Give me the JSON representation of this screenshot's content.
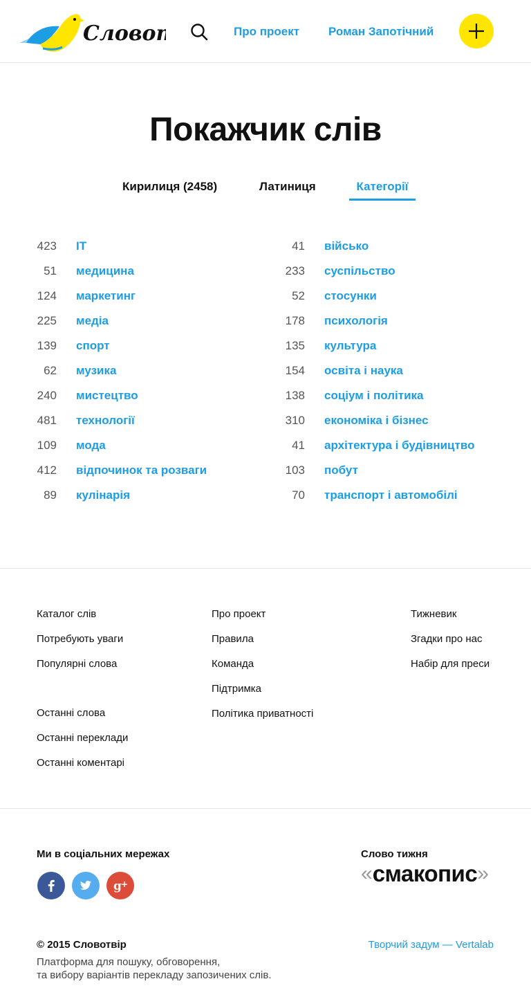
{
  "header": {
    "logo_text": "Словотвір",
    "nav": {
      "about": "Про проект",
      "user": "Роман Запотічний"
    }
  },
  "page": {
    "title": "Покажчик слів",
    "tabs": {
      "cyrillic": "Кирилиця (2458)",
      "latin": "Латиниця",
      "categories": "Категорії"
    }
  },
  "categories": {
    "left": [
      {
        "count": "423",
        "name": "IT"
      },
      {
        "count": "51",
        "name": "медицина"
      },
      {
        "count": "124",
        "name": "маркетинг"
      },
      {
        "count": "225",
        "name": "медіа"
      },
      {
        "count": "139",
        "name": "спорт"
      },
      {
        "count": "62",
        "name": "музика"
      },
      {
        "count": "240",
        "name": "мистецтво"
      },
      {
        "count": "481",
        "name": "технології"
      },
      {
        "count": "109",
        "name": "мода"
      },
      {
        "count": "412",
        "name": "відпочинок та розваги"
      },
      {
        "count": "89",
        "name": "кулінарія"
      }
    ],
    "right": [
      {
        "count": "41",
        "name": "військо"
      },
      {
        "count": "233",
        "name": "суспільство"
      },
      {
        "count": "52",
        "name": "стосунки"
      },
      {
        "count": "178",
        "name": "психологія"
      },
      {
        "count": "135",
        "name": "культура"
      },
      {
        "count": "154",
        "name": "освіта і наука"
      },
      {
        "count": "138",
        "name": "соціум і політика"
      },
      {
        "count": "310",
        "name": "економіка і бізнес"
      },
      {
        "count": "41",
        "name": "архітектура і будівництво"
      },
      {
        "count": "103",
        "name": "побут"
      },
      {
        "count": "70",
        "name": "транспорт і автомобілі"
      }
    ]
  },
  "footer": {
    "col1a": [
      "Каталог слів",
      "Потребують уваги",
      "Популярні слова"
    ],
    "col1b": [
      "Останні слова",
      "Останні переклади",
      "Останні коментарі"
    ],
    "col2": [
      "Про проект",
      "Правила",
      "Команда",
      "Підтримка",
      "Політика приватності"
    ],
    "col3": [
      "Тижневик",
      "Згадки про нас",
      "Набір для преси"
    ],
    "social_title": "Ми в соціальних мережах",
    "word_of_week_title": "Слово тижня",
    "word_of_week": "смакопис",
    "quote_open": "«",
    "quote_close": "»",
    "copyright": "© 2015 Словотвір",
    "tagline_1": "Платформа для пошуку, обговорення,",
    "tagline_2": "та вибору варіантів перекладу запозичених слів.",
    "credit": "Творчий задум — Vertalab"
  },
  "colors": {
    "accent": "#1d9de4",
    "yellow": "#ffe500",
    "facebook": "#3b5998",
    "twitter": "#55acee",
    "googleplus": "#dd4b39"
  },
  "icons": {
    "search": "search-icon",
    "add": "plus-icon",
    "facebook": "facebook-icon",
    "twitter": "twitter-icon",
    "googleplus": "google-plus-icon",
    "bird": "bird-logo-icon"
  }
}
